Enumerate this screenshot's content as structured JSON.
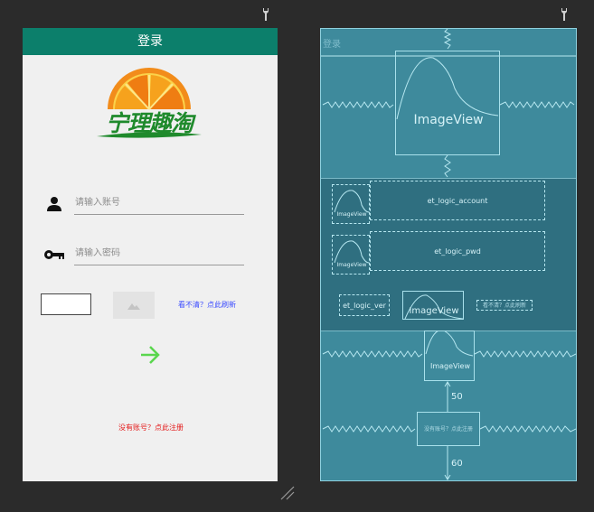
{
  "design": {
    "title": "登录",
    "logo_text": "宁理趣淘",
    "account_hint": "请输入账号",
    "password_hint": "请输入密码",
    "refresh_link": "看不清？点此刷新",
    "register_link": "没有账号？点此注册"
  },
  "blueprint": {
    "title": "登录",
    "logo_label": "ImageView",
    "account_icon_label": "ImageView",
    "account_field": "et_logic_account",
    "password_icon_label": "ImageView",
    "password_field": "et_logic_pwd",
    "captcha_field": "et_logic_ver",
    "captcha_image_label": "ImageView",
    "refresh_label": "看不清？点此刷新",
    "arrow_label": "ImageView",
    "register_label": "没有账号？点此注册",
    "margin_top": "50",
    "margin_bottom": "60"
  },
  "colors": {
    "title_bar": "#0c7f6b",
    "blueprint_bg": "#3e8a9c",
    "link_blue": "#3b4cff",
    "link_red": "#e41a1a",
    "arrow_green": "#5ad64e"
  },
  "icons": [
    "wrench-icon",
    "person-icon",
    "key-icon",
    "image-placeholder-icon",
    "arrow-right-icon",
    "resize-handle-icon"
  ]
}
